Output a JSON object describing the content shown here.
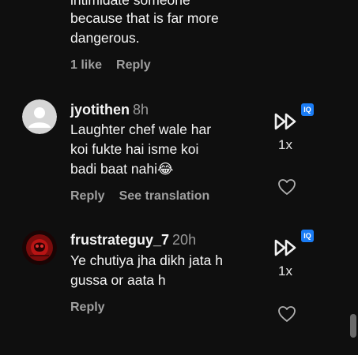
{
  "prev_comment": {
    "line1": "intimidate someone",
    "line2": "because that is far more",
    "line3": "dangerous.",
    "likes": "1 like",
    "reply": "Reply"
  },
  "comments": [
    {
      "username": "jyotithen",
      "time": "8h",
      "line1": "Laughter chef wale har",
      "line2": "koi fukte hai isme koi",
      "line3": "badi baat nahi😂",
      "reply": "Reply",
      "translate": "See translation",
      "speed": "1x",
      "badge": "IQ"
    },
    {
      "username": "frustrateguy_7",
      "time": "20h",
      "line1": "Ye chutiya jha dikh jata h",
      "line2": "gussa or aata h",
      "reply": "Reply",
      "speed": "1x",
      "badge": "IQ"
    }
  ],
  "icons": {
    "speed": "fast-forward-icon",
    "like": "heart-icon",
    "badge": "iq-badge-icon"
  },
  "colors": {
    "background": "#0f0f0f",
    "meta_text": "#a0a0a0",
    "badge": "#1a7cf5"
  }
}
